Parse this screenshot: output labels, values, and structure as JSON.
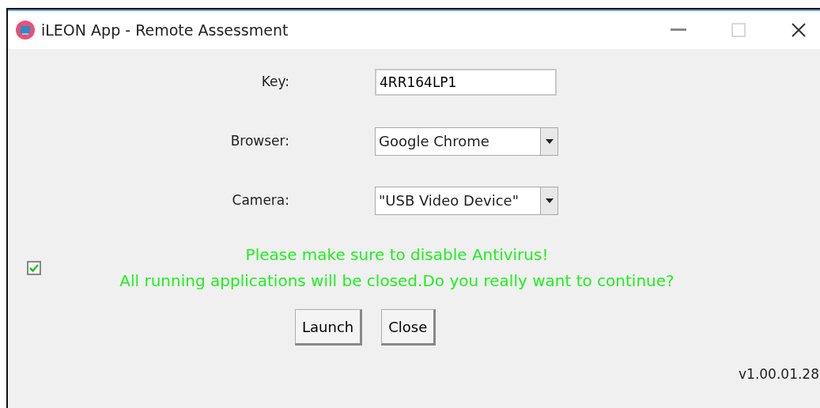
{
  "window": {
    "title": "iLEON App - Remote Assessment"
  },
  "fields": [
    {
      "kind": "text",
      "label": "Key:",
      "value": "4RR164LP1"
    },
    {
      "kind": "dropdown",
      "label": "Browser:",
      "value": "Google Chrome"
    },
    {
      "kind": "dropdown",
      "label": "Camera:",
      "value": "\"USB Video Device\""
    }
  ],
  "confirm": {
    "checked": true,
    "lines": [
      "Please make sure to disable Antivirus!",
      "All running applications will be closed.Do you really want to continue?"
    ]
  },
  "buttons": [
    "Launch",
    "Close"
  ],
  "version": "v1.00.01.28"
}
